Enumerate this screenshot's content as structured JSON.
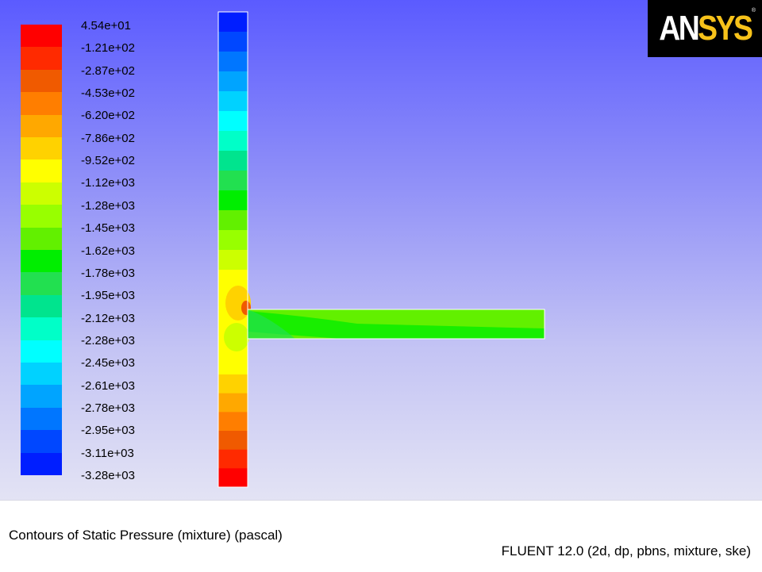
{
  "brand": {
    "logo_text_a": "AN",
    "logo_text_b": "SYS",
    "registered_mark": "®"
  },
  "colorbar": {
    "labels": [
      "4.54e+01",
      "-1.21e+02",
      "-2.87e+02",
      "-4.53e+02",
      "-6.20e+02",
      "-7.86e+02",
      "-9.52e+02",
      "-1.12e+03",
      "-1.28e+03",
      "-1.45e+03",
      "-1.62e+03",
      "-1.78e+03",
      "-1.95e+03",
      "-2.12e+03",
      "-2.28e+03",
      "-2.45e+03",
      "-2.61e+03",
      "-2.78e+03",
      "-2.95e+03",
      "-3.11e+03",
      "-3.28e+03"
    ],
    "colors": [
      "#ff0000",
      "#ff2a00",
      "#f05a00",
      "#ff7e00",
      "#ffa800",
      "#ffd200",
      "#ffff00",
      "#ccff00",
      "#98ff00",
      "#62f000",
      "#00ee00",
      "#22e050",
      "#00e48e",
      "#00ffc8",
      "#00ffff",
      "#00d2ff",
      "#00a4ff",
      "#0076ff",
      "#0047ff",
      "#001eff"
    ]
  },
  "field": {
    "vertical_pipe_colors_top_to_bottom": [
      "#001eff",
      "#0047ff",
      "#0076ff",
      "#00a4ff",
      "#00d2ff",
      "#00ffff",
      "#00ffc8",
      "#00e48e",
      "#22e050",
      "#00ee00",
      "#62f000",
      "#98ff00",
      "#ccff00"
    ],
    "lower_pipe_colors_top_to_bottom": [
      "#ffd200",
      "#ffa800",
      "#ff7e00",
      "#f05a00",
      "#ff2a00",
      "#ff0000"
    ],
    "junction_color": "#ffff00",
    "branch_color": "#62f000"
  },
  "footer": {
    "caption": "Contours of Static Pressure (mixture)  (pascal)",
    "solver_info": "FLUENT 12.0 (2d, dp, pbns, mixture, ske)"
  }
}
